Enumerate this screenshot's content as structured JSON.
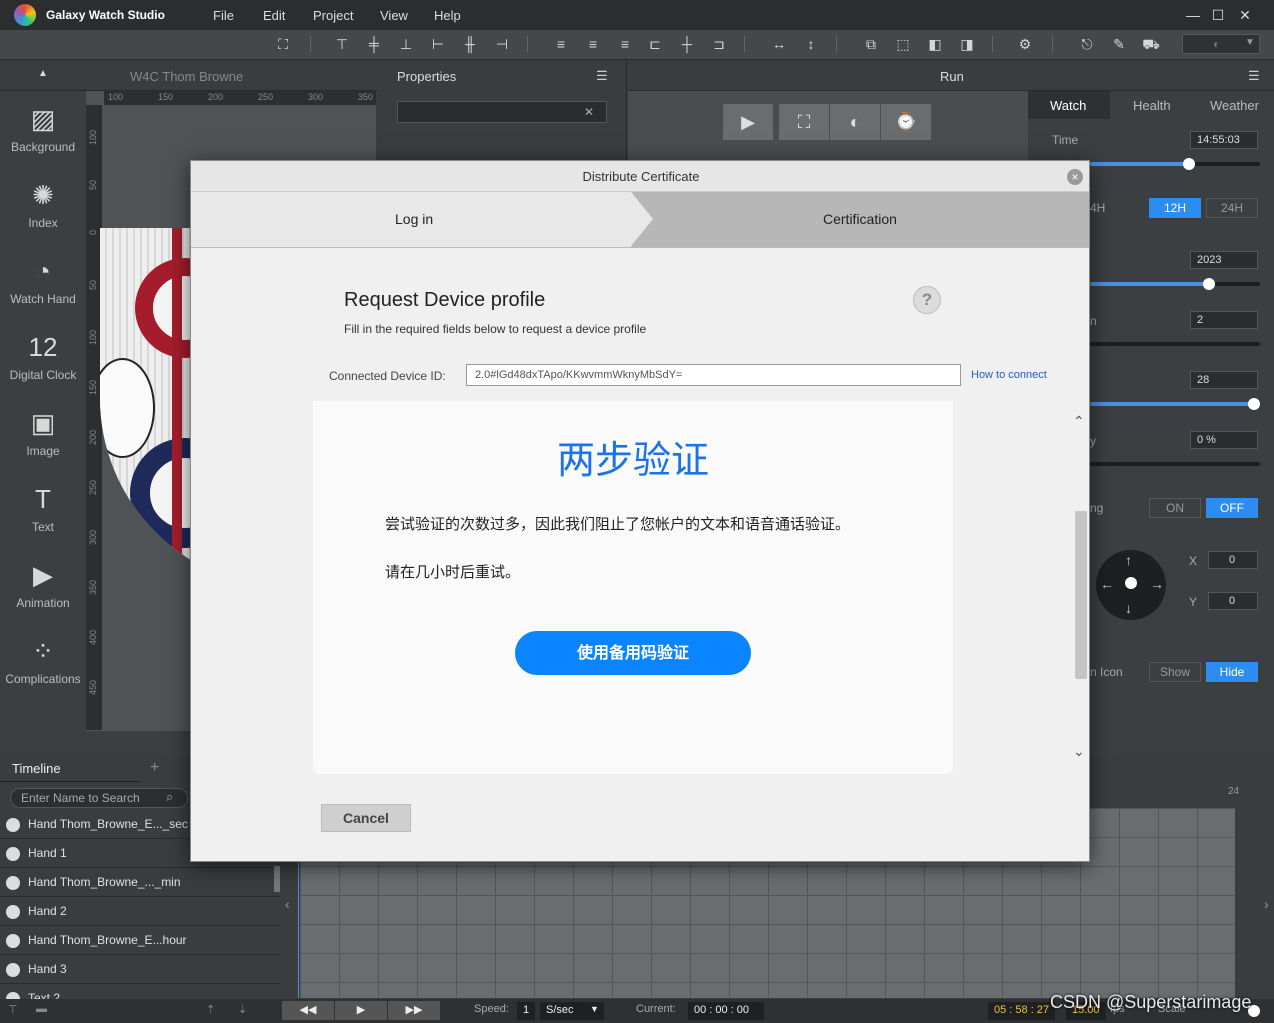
{
  "app": {
    "title": "Galaxy Watch Studio"
  },
  "menu": [
    "File",
    "Edit",
    "Project",
    "View",
    "Help"
  ],
  "window": {
    "minimize": "—",
    "maximize": "☐",
    "close": "✕"
  },
  "panels": {
    "project_name": "W4C Thom Browne",
    "properties": "Properties",
    "run": "Run"
  },
  "ruler_top": [
    "100",
    "150",
    "200",
    "250",
    "300",
    "350"
  ],
  "ruler_left": [
    "100",
    "50",
    "0",
    "50",
    "100",
    "150",
    "200",
    "250",
    "300",
    "350",
    "400",
    "450"
  ],
  "tools": [
    {
      "label": "Background",
      "icon": "background-icon",
      "glyph": "▨"
    },
    {
      "label": "Index",
      "icon": "index-icon",
      "glyph": "✺"
    },
    {
      "label": "Watch Hand",
      "icon": "watch-hand-icon",
      "glyph": "◔"
    },
    {
      "label": "Digital Clock",
      "icon": "digital-clock-icon",
      "glyph": "12"
    },
    {
      "label": "Image",
      "icon": "image-icon",
      "glyph": "▣"
    },
    {
      "label": "Text",
      "icon": "text-icon",
      "glyph": "T"
    },
    {
      "label": "Animation",
      "icon": "animation-icon",
      "glyph": "▶"
    },
    {
      "label": "Complications",
      "icon": "complications-icon",
      "glyph": "⁘"
    }
  ],
  "run_panel": {
    "tabs": [
      "Watch",
      "Health",
      "Weather"
    ],
    "time_label": "Time",
    "time_value": "14:55:03",
    "time_slider": 0.58,
    "hour_partial": "4H",
    "hour_options": [
      "12H",
      "24H"
    ],
    "year_value": "2023",
    "year_slider": 0.7,
    "field2": "2",
    "partial_a": "n",
    "field3": "28",
    "field3_slider": 1.0,
    "field4": "0 %",
    "partial_b": "y",
    "partial_c": "ng",
    "toggle_on": "ON",
    "toggle_off": "OFF",
    "x_label": "X",
    "x_value": "0",
    "y_label": "Y",
    "y_value": "0",
    "icon_label": "n Icon",
    "show": "Show",
    "hide": "Hide"
  },
  "timeline": {
    "title": "Timeline",
    "add": "+",
    "search_placeholder": "Enter Name to Search",
    "frame_label": "24",
    "rows": [
      "Hand Thom_Browne_E..._sec",
      "Hand 1",
      "Hand Thom_Browne_..._min",
      "Hand 2",
      "Hand Thom_Browne_E...hour",
      "Hand 3",
      "Text 2"
    ]
  },
  "bottom": {
    "speed_label": "Speed:",
    "speed_value": "1",
    "speed_unit": "S/sec",
    "current_label": "Current:",
    "current_value": "00 : 00 : 00",
    "time_display": "05 : 58 : 27",
    "fps_value": "15.00",
    "fps_label": "fps",
    "scale_label": "Scale"
  },
  "dialog": {
    "title": "Distribute Certificate",
    "close": "×",
    "step1": "Log in",
    "step2": "Certification",
    "heading": "Request Device profile",
    "subheading": "Fill in the required fields below to request a device profile",
    "help": "?",
    "device_label": "Connected Device ID:",
    "device_value": "2.0#lGd48dxTApo/KKwvmmWknyMbSdY=",
    "how_to": "How to connect",
    "web_title": "两步验证",
    "web_msg1": "尝试验证的次数过多，因此我们阻止了您帐户的文本和语音通话验证。",
    "web_msg2": "请在几小时后重试。",
    "web_button": "使用备用码验证",
    "cancel": "Cancel"
  },
  "watermark": "CSDN @Superstarimage"
}
